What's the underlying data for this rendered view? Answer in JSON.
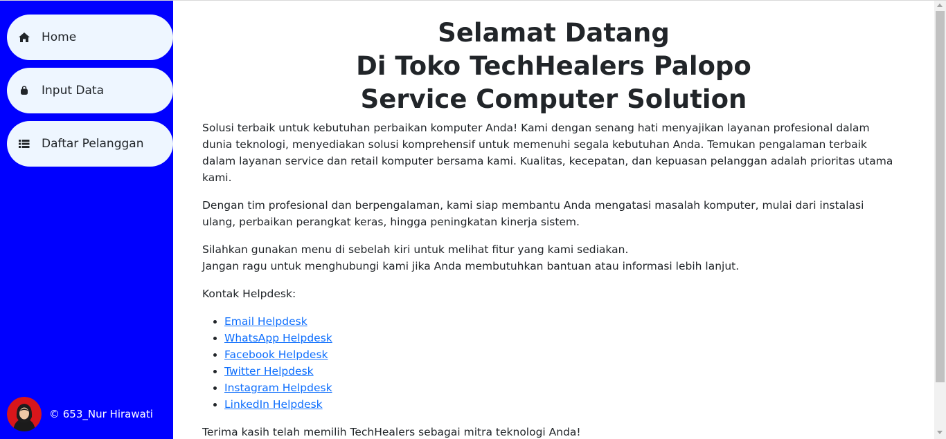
{
  "sidebar": {
    "items": [
      {
        "label": "Home",
        "icon": "home-icon"
      },
      {
        "label": "Input Data",
        "icon": "bag-icon"
      },
      {
        "label": "Daftar Pelanggan",
        "icon": "list-icon"
      }
    ],
    "footer": {
      "credit": "© 653_Nur Hirawati"
    },
    "background": "#0000ff"
  },
  "main": {
    "title_lines": [
      "Selamat Datang",
      "Di Toko TechHealers Palopo",
      "Service Computer Solution"
    ],
    "paragraphs": [
      "Solusi terbaik untuk kebutuhan perbaikan komputer Anda! Kami dengan senang hati menyajikan layanan profesional dalam dunia teknologi, menyediakan solusi komprehensif untuk memenuhi segala kebutuhan Anda. Temukan pengalaman terbaik dalam layanan service dan retail komputer bersama kami. Kualitas, kecepatan, dan kepuasan pelanggan adalah prioritas utama kami.",
      "Dengan tim profesional dan berpengalaman, kami siap membantu Anda mengatasi masalah komputer, mulai dari instalasi ulang, perbaikan perangkat keras, hingga peningkatan kinerja sistem."
    ],
    "menu_hint_line1": "Silahkan gunakan menu di sebelah kiri untuk melihat fitur yang kami sediakan.",
    "menu_hint_line2": "Jangan ragu untuk menghubungi kami jika Anda membutuhkan bantuan atau informasi lebih lanjut.",
    "helpdesk_heading": "Kontak Helpdesk:",
    "helpdesk_links": [
      "Email Helpdesk",
      "WhatsApp Helpdesk",
      "Facebook Helpdesk",
      "Twitter Helpdesk",
      "Instagram Helpdesk",
      "LinkedIn Helpdesk"
    ],
    "closing": "Terima kasih telah memilih TechHealers sebagai mitra teknologi Anda!"
  }
}
